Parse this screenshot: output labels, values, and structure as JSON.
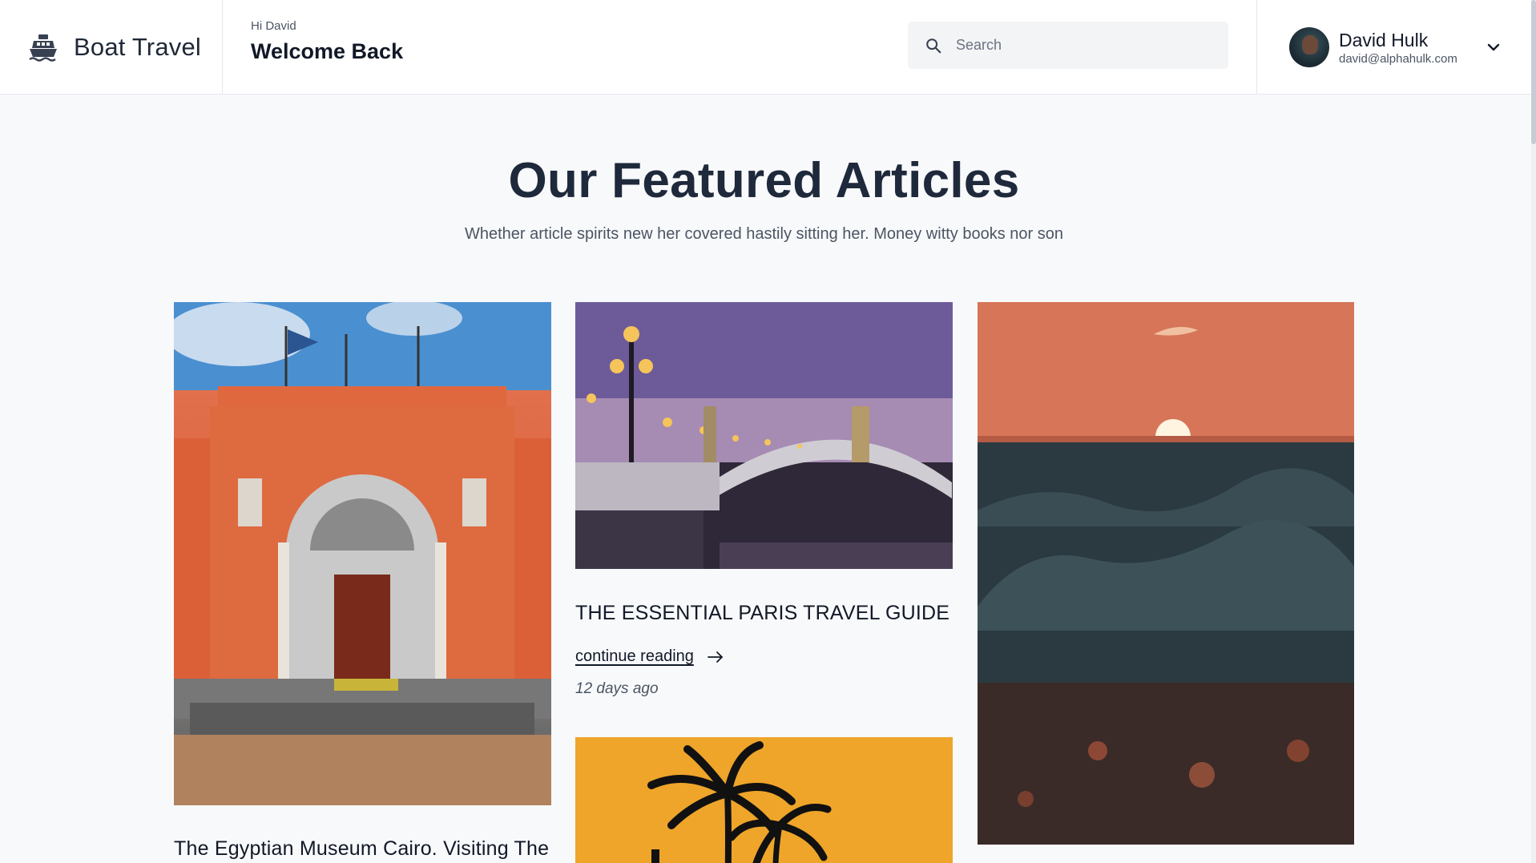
{
  "header": {
    "brand_name": "Boat Travel",
    "brand_icon": "ship-icon",
    "greeting_small": "Hi David",
    "greeting_large": "Welcome Back",
    "search_placeholder": "Search",
    "user_name": "David Hulk",
    "user_email": "david@alphahulk.com"
  },
  "section": {
    "title": "Our Featured Articles",
    "subtitle": "Whether article spirits new her covered hastily sitting her. Money witty books nor son"
  },
  "articles": [
    {
      "title": "The Egyptian Museum Cairo. Visiting The",
      "image": "museum-photo"
    },
    {
      "title": "THE ESSENTIAL PARIS TRAVEL GUIDE",
      "link_label": "continue reading",
      "time": "12 days ago",
      "image": "paris-bridge-photo"
    },
    {
      "image": "ocean-sunset-photo"
    },
    {
      "image": "palm-trees-photo"
    }
  ],
  "colors": {
    "background": "#f8f9fb",
    "header_bg": "#ffffff",
    "title_text": "#1e293b",
    "search_bg": "#f3f4f6"
  }
}
